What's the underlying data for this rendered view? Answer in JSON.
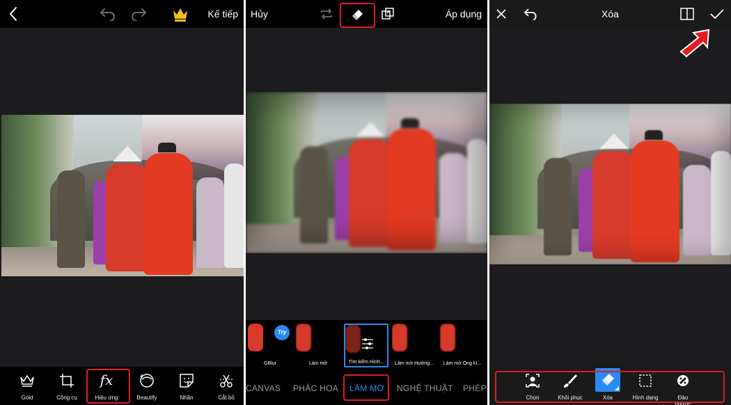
{
  "panel1": {
    "top_bar": {
      "next_label": "Kế tiếp"
    },
    "tools": [
      {
        "label": "Gold",
        "icon": "crown-outline-icon"
      },
      {
        "label": "Công cụ",
        "icon": "crop-icon"
      },
      {
        "label": "Hiệu ứng",
        "icon": "fx-icon"
      },
      {
        "label": "Beautify",
        "icon": "face-icon"
      },
      {
        "label": "Nhãn",
        "icon": "sticker-icon"
      },
      {
        "label": "Cắt bỏ",
        "icon": "cutout-scissors-icon"
      }
    ]
  },
  "panel2": {
    "top_bar": {
      "cancel_label": "Hủy",
      "apply_label": "Áp dụng"
    },
    "thumbnails": [
      {
        "caption": "GBlur",
        "badge": "Try"
      },
      {
        "caption": "Làm mờ"
      },
      {
        "caption": "Tìm kiếm Hình..."
      },
      {
        "caption": "Làm mờ Hướng..."
      },
      {
        "caption": "Làm mờ Ống kí..."
      }
    ],
    "categories": [
      "CANVAS",
      "PHÁC HỌA",
      "LÀM MỜ",
      "NGHỆ THUẬT",
      "PHÉP"
    ],
    "active_category": "LÀM MỜ"
  },
  "panel3": {
    "top_bar": {
      "title": "Xóa"
    },
    "tools": [
      {
        "label": "Chọn",
        "icon": "person-select-icon"
      },
      {
        "label": "Khôi phục",
        "icon": "brush-icon"
      },
      {
        "label": "Xóa",
        "icon": "eraser-icon"
      },
      {
        "label": "Hình dạng",
        "icon": "dashed-square-icon"
      },
      {
        "label": "Đảo ngược",
        "icon": "invert-icon"
      }
    ]
  },
  "colors": {
    "highlight_red": "#e01b24",
    "accent_blue": "#2a8cf0",
    "crown_gold": "#f6c21b",
    "panel_bg": "#1c1c1e",
    "bar_bg": "#000000"
  }
}
